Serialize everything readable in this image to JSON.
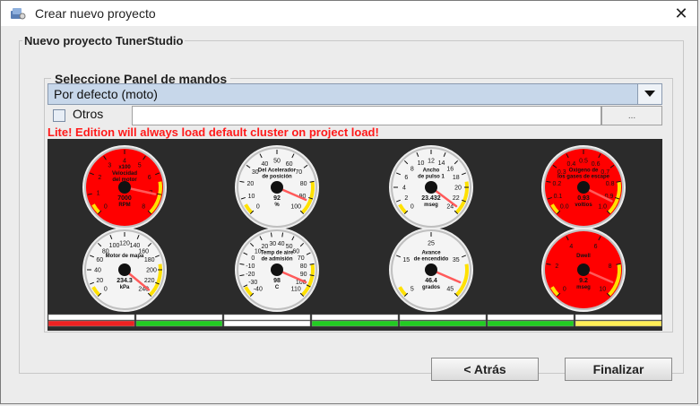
{
  "window": {
    "title": "Crear nuevo proyecto",
    "close_label": "✕"
  },
  "group": {
    "title": "Nuevo proyecto TunerStudio"
  },
  "panel": {
    "title": "Seleccione Panel de mandos",
    "selected": "Por defecto (moto)",
    "others_label": "Otros",
    "browse_label": "...",
    "warning": "Lite! Edition will always load default cluster on project load!"
  },
  "gauges": [
    {
      "name": "rpm",
      "lines": [
        "x100",
        "Velocidad",
        "del motor"
      ],
      "value": "7000",
      "unit": "RPM",
      "face": "#ff0000",
      "ticks": [
        "0",
        "1",
        "2",
        "3",
        "4",
        "5",
        "6",
        "7",
        "8"
      ],
      "needle_frac": 0.88
    },
    {
      "name": "tps",
      "lines": [
        "Del Acelerador",
        "de posición"
      ],
      "value": "92",
      "unit": "%",
      "face": "#f4f4f4",
      "ticks": [
        "0",
        "10",
        "20",
        "30",
        "40",
        "50",
        "60",
        "70",
        "80",
        "90",
        "100"
      ],
      "needle_frac": 0.92
    },
    {
      "name": "pulse",
      "lines": [
        "Ancho",
        "de pulso 1"
      ],
      "value": "23.432",
      "unit": "mseg",
      "face": "#f4f4f4",
      "ticks": [
        "0",
        "2",
        "4",
        "6",
        "8",
        "10",
        "12",
        "14",
        "16",
        "18",
        "20",
        "22",
        "24"
      ],
      "needle_frac": 0.97
    },
    {
      "name": "o2",
      "lines": [
        "Oxigeno de",
        "los gases de escape"
      ],
      "value": "0.93",
      "unit": "voltios",
      "face": "#ff0000",
      "ticks": [
        "0.0",
        "0.1",
        "0.2",
        "0.3",
        "0.4",
        "0.5",
        "0.6",
        "0.7",
        "0.8",
        "0.9",
        "1.0"
      ],
      "needle_frac": 0.93
    },
    {
      "name": "map",
      "lines": [
        "Motor de mapa"
      ],
      "value": "234.3",
      "unit": "kPa",
      "face": "#f4f4f4",
      "ticks": [
        "0",
        "20",
        "40",
        "60",
        "80",
        "100",
        "120",
        "140",
        "160",
        "180",
        "200",
        "220",
        "240"
      ],
      "needle_frac": 0.98
    },
    {
      "name": "iat",
      "lines": [
        "Temp de aire",
        "de admisión"
      ],
      "value": "98",
      "unit": "C",
      "face": "#f4f4f4",
      "ticks": [
        "-40",
        "-30",
        "-20",
        "-10",
        "0",
        "10",
        "20",
        "30",
        "40",
        "50",
        "60",
        "70",
        "80",
        "90",
        "100",
        "110"
      ],
      "needle_frac": 0.92
    },
    {
      "name": "adv",
      "lines": [
        "Avance",
        "de encendido"
      ],
      "value": "46.4",
      "unit": "grados",
      "face": "#f4f4f4",
      "ticks": [
        "5",
        "15",
        "25",
        "35",
        "45"
      ],
      "needle_frac": 0.92
    },
    {
      "name": "dwell",
      "lines": [
        "Dwell"
      ],
      "value": "9.2",
      "unit": "mseg",
      "face": "#ff0000",
      "ticks": [
        "0",
        "2",
        "4",
        "6",
        "8",
        "10"
      ],
      "needle_frac": 0.92
    }
  ],
  "indicators": [
    {
      "top": "#ffffff",
      "bottom": "#ee2222"
    },
    {
      "top": "#ffffff",
      "bottom": "#22cc22"
    },
    {
      "top": "#ffffff",
      "bottom": "#ffffff"
    },
    {
      "top": "#ffffff",
      "bottom": "#22cc22"
    },
    {
      "top": "#ffffff",
      "bottom": "#22cc22"
    },
    {
      "top": "#ffffff",
      "bottom": "#22cc22"
    },
    {
      "top": "#ffffff",
      "bottom": "#ffee55"
    }
  ],
  "buttons": {
    "back": "< Atrás",
    "finish": "Finalizar"
  }
}
